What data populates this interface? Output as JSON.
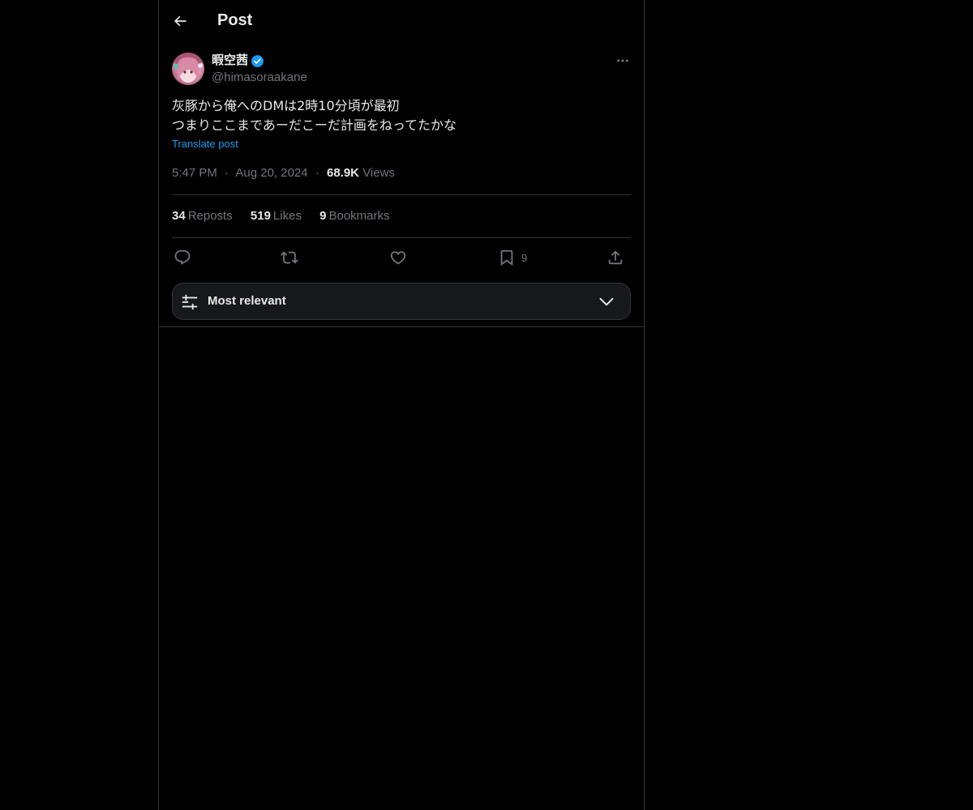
{
  "header": {
    "title": "Post",
    "back_icon": "arrow-left-icon"
  },
  "author": {
    "display_name": "暇空茜",
    "handle": "@himasoraakane",
    "verified_icon": "verified-badge-icon",
    "verified_color": "#1d9bf0"
  },
  "post": {
    "lines": [
      "灰豚から俺へのDMは2時10分頃が最初",
      "つまりここまであーだこーだ計画をねってたかな"
    ],
    "translate_label": "Translate post",
    "time": "5:47 PM",
    "date": "Aug 20, 2024",
    "views_count": "68.9K",
    "views_label": "Views",
    "separator": "·"
  },
  "stats": [
    {
      "count": "34",
      "label": "Reposts"
    },
    {
      "count": "519",
      "label": "Likes"
    },
    {
      "count": "9",
      "label": "Bookmarks"
    }
  ],
  "actions": {
    "reply_icon": "reply-icon",
    "repost_icon": "repost-icon",
    "like_icon": "heart-icon",
    "bookmark_icon": "bookmark-icon",
    "bookmark_count": "9",
    "share_icon": "share-icon"
  },
  "sort": {
    "label": "Most relevant",
    "icon": "sliders-icon",
    "chevron": "chevron-down-icon"
  },
  "colors": {
    "background": "#000000",
    "text": "#e7e9ea",
    "muted": "#71767b",
    "accent": "#1d9bf0",
    "border": "#2f3336"
  }
}
